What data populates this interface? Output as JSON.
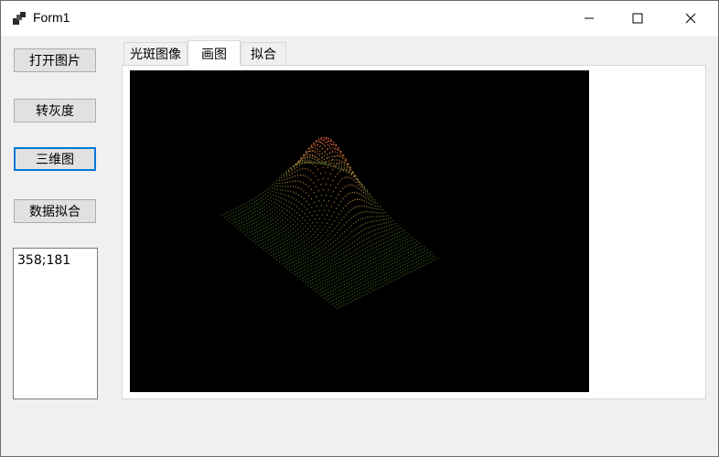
{
  "window": {
    "title": "Form1"
  },
  "left_panel": {
    "buttons": [
      {
        "label": "打开图片"
      },
      {
        "label": "转灰度"
      },
      {
        "label": "三维图"
      },
      {
        "label": "数据拟合"
      }
    ],
    "textbox_value": "358;181"
  },
  "tabs": [
    {
      "label": "光斑图像"
    },
    {
      "label": "画图"
    },
    {
      "label": "拟合"
    }
  ],
  "plot": {
    "background": "#000000",
    "surface_colors": {
      "low": "#3c5a1e",
      "mid": "#a0823c",
      "peak": "#dc5532"
    }
  }
}
